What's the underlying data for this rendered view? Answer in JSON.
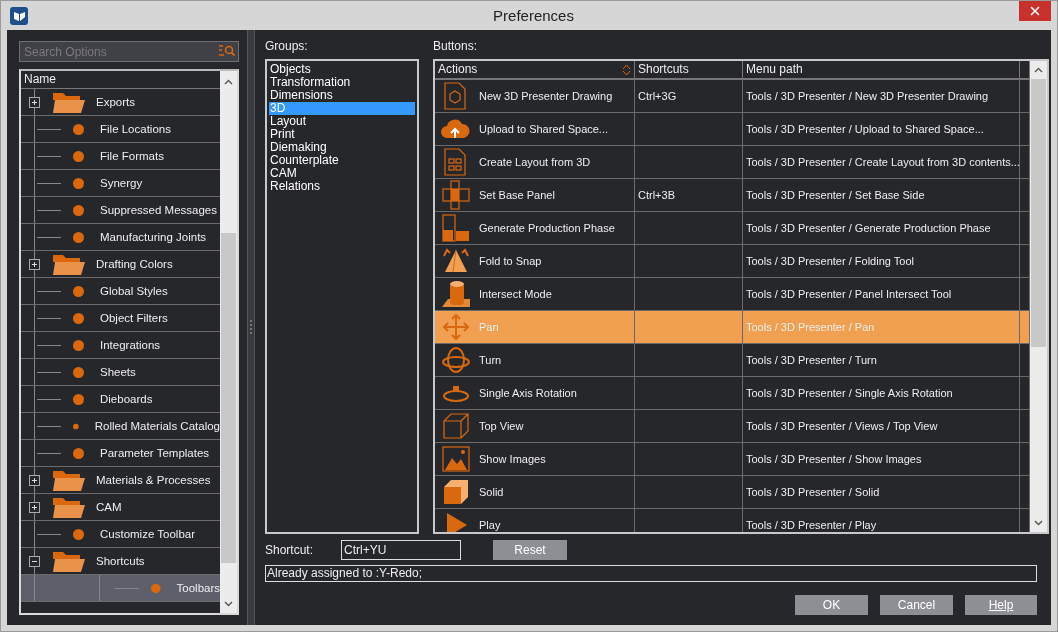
{
  "window": {
    "title": "Preferences"
  },
  "search": {
    "placeholder": "Search Options"
  },
  "tree": {
    "column": "Name",
    "items": [
      {
        "label": "Exports",
        "kind": "folder",
        "expanded": false,
        "selected": false
      },
      {
        "label": "File Locations",
        "kind": "leaf",
        "selected": false
      },
      {
        "label": "File Formats",
        "kind": "leaf",
        "selected": false
      },
      {
        "label": "Synergy",
        "kind": "leaf",
        "selected": false
      },
      {
        "label": "Suppressed Messages",
        "kind": "leaf",
        "selected": false
      },
      {
        "label": "Manufacturing Joints",
        "kind": "leaf",
        "selected": false
      },
      {
        "label": "Drafting Colors",
        "kind": "folder",
        "expanded": false,
        "selected": false
      },
      {
        "label": "Global Styles",
        "kind": "leaf",
        "selected": false
      },
      {
        "label": "Object Filters",
        "kind": "leaf",
        "selected": false
      },
      {
        "label": "Integrations",
        "kind": "leaf",
        "selected": false
      },
      {
        "label": "Sheets",
        "kind": "leaf",
        "selected": false
      },
      {
        "label": "Dieboards",
        "kind": "leaf",
        "selected": false
      },
      {
        "label": "Rolled Materials Catalog",
        "kind": "leaf",
        "selected": false
      },
      {
        "label": "Parameter Templates",
        "kind": "leaf",
        "selected": false
      },
      {
        "label": "Materials & Processes",
        "kind": "folder",
        "expanded": false,
        "selected": false
      },
      {
        "label": "CAM",
        "kind": "folder",
        "expanded": false,
        "selected": false
      },
      {
        "label": "Customize Toolbar",
        "kind": "leaf",
        "selected": false
      },
      {
        "label": "Shortcuts",
        "kind": "folder",
        "expanded": true,
        "selected": false,
        "children": [
          {
            "label": "Toolbars",
            "kind": "leaf",
            "selected": true
          }
        ]
      }
    ]
  },
  "groups": {
    "label": "Groups:",
    "items": [
      {
        "label": "Objects",
        "selected": false
      },
      {
        "label": "Transformation",
        "selected": false
      },
      {
        "label": "Dimensions",
        "selected": false
      },
      {
        "label": "3D",
        "selected": true
      },
      {
        "label": "Layout",
        "selected": false
      },
      {
        "label": "Print",
        "selected": false
      },
      {
        "label": "Diemaking",
        "selected": false
      },
      {
        "label": "Counterplate",
        "selected": false
      },
      {
        "label": "CAM",
        "selected": false
      },
      {
        "label": "Relations",
        "selected": false
      }
    ]
  },
  "buttons": {
    "label": "Buttons:",
    "columns": [
      "Actions",
      "Shortcuts",
      "Menu path"
    ],
    "rows": [
      {
        "action": "New 3D Presenter Drawing",
        "shortcut": "Ctrl+3G",
        "path": "Tools / 3D Presenter / New 3D Presenter Drawing",
        "selected": false
      },
      {
        "action": "Upload to Shared Space...",
        "shortcut": "",
        "path": "Tools / 3D Presenter / Upload to Shared Space...",
        "selected": false
      },
      {
        "action": "Create Layout from 3D",
        "shortcut": "",
        "path": "Tools / 3D Presenter / Create Layout from 3D contents...",
        "selected": false
      },
      {
        "action": "Set Base Panel",
        "shortcut": "Ctrl+3B",
        "path": "Tools / 3D Presenter / Set Base Side",
        "selected": false
      },
      {
        "action": "Generate Production Phase",
        "shortcut": "",
        "path": "Tools / 3D Presenter / Generate Production Phase",
        "selected": false
      },
      {
        "action": "Fold to Snap",
        "shortcut": "",
        "path": "Tools / 3D Presenter / Folding Tool",
        "selected": false
      },
      {
        "action": "Intersect Mode",
        "shortcut": "",
        "path": "Tools / 3D Presenter / Panel Intersect Tool",
        "selected": false
      },
      {
        "action": "Pan",
        "shortcut": "",
        "path": "Tools / 3D Presenter / Pan",
        "selected": true
      },
      {
        "action": "Turn",
        "shortcut": "",
        "path": "Tools / 3D Presenter / Turn",
        "selected": false
      },
      {
        "action": "Single Axis Rotation",
        "shortcut": "",
        "path": "Tools / 3D Presenter / Single Axis Rotation",
        "selected": false
      },
      {
        "action": "Top View",
        "shortcut": "",
        "path": "Tools / 3D Presenter / Views / Top View",
        "selected": false
      },
      {
        "action": "Show Images",
        "shortcut": "",
        "path": "Tools / 3D Presenter / Show Images",
        "selected": false
      },
      {
        "action": "Solid",
        "shortcut": "",
        "path": "Tools / 3D Presenter / Solid",
        "selected": false
      },
      {
        "action": "Play",
        "shortcut": "",
        "path": "Tools / 3D Presenter / Play",
        "selected": false
      }
    ]
  },
  "shortcut": {
    "label": "Shortcut:",
    "value": "Ctrl+YU",
    "reset": "Reset"
  },
  "status": "Already assigned to :Y-Redo;",
  "dialog_buttons": [
    "OK",
    "Cancel",
    "Help"
  ]
}
